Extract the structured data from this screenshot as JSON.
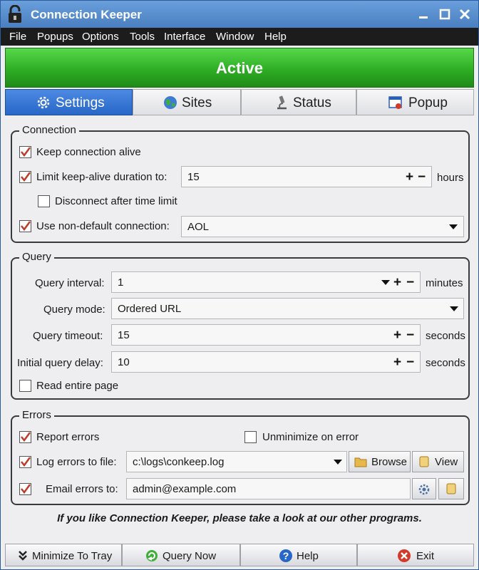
{
  "window": {
    "title": "Connection Keeper"
  },
  "menu": [
    "File",
    "Popups",
    "Options",
    "Tools",
    "Interface",
    "Window",
    "Help"
  ],
  "status": {
    "label": "Active",
    "color": "#2fae25"
  },
  "tabs": [
    {
      "label": "Settings",
      "icon": "gear-icon",
      "selected": true
    },
    {
      "label": "Sites",
      "icon": "globe-icon",
      "selected": false
    },
    {
      "label": "Status",
      "icon": "microscope-icon",
      "selected": false
    },
    {
      "label": "Popup",
      "icon": "popup-window-icon",
      "selected": false
    }
  ],
  "connection": {
    "legend": "Connection",
    "keep_alive": {
      "label": "Keep connection alive",
      "checked": true
    },
    "limit_duration": {
      "label": "Limit keep-alive duration to:",
      "checked": true,
      "value": "15",
      "unit": "hours"
    },
    "disconnect_after": {
      "label": "Disconnect after time limit",
      "checked": false
    },
    "non_default": {
      "label": "Use non-default connection:",
      "checked": true,
      "value": "AOL"
    }
  },
  "query": {
    "legend": "Query",
    "interval": {
      "label": "Query interval:",
      "value": "1",
      "unit": "minutes"
    },
    "mode": {
      "label": "Query mode:",
      "value": "Ordered URL"
    },
    "timeout": {
      "label": "Query timeout:",
      "value": "15",
      "unit": "seconds"
    },
    "initial_delay": {
      "label": "Initial query delay:",
      "value": "10",
      "unit": "seconds"
    },
    "read_entire": {
      "label": "Read entire page",
      "checked": false
    }
  },
  "errors": {
    "legend": "Errors",
    "report": {
      "label": "Report errors",
      "checked": true
    },
    "unminimize": {
      "label": "Unminimize on error",
      "checked": false
    },
    "log_file": {
      "label": "Log errors to file:",
      "checked": true,
      "value": "c:\\logs\\conkeep.log",
      "browse": "Browse",
      "view": "View"
    },
    "email": {
      "label": "Email errors to:",
      "checked": true,
      "value": "admin@example.com"
    }
  },
  "promo": "If you like Connection Keeper, please take a look at our other programs.",
  "bottom": {
    "minimize": "Minimize To Tray",
    "query_now": "Query Now",
    "help": "Help",
    "exit": "Exit"
  },
  "colors": {
    "accent": "#2866c8",
    "check": "#c0392b"
  }
}
